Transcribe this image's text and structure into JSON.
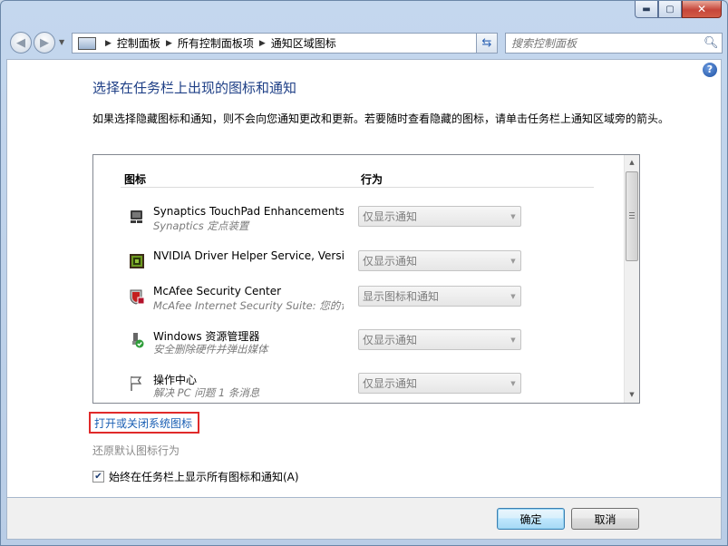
{
  "window": {
    "caption_buttons": {
      "minimize": "▬",
      "maximize": "▢",
      "close": "✕"
    }
  },
  "nav": {
    "back_glyph": "◀",
    "forward_glyph": "▶",
    "breadcrumbs": [
      "控制面板",
      "所有控制面板项",
      "通知区域图标"
    ],
    "search_placeholder": "搜索控制面板"
  },
  "page": {
    "title": "选择在任务栏上出现的图标和通知",
    "description": "如果选择隐藏图标和通知，则不会向您通知更改和更新。若要随时查看隐藏的图标，请单击任务栏上通知区域旁的箭头。",
    "columns": {
      "icon": "图标",
      "behavior": "行为"
    },
    "rows": [
      {
        "icon": "touchpad-icon",
        "name": "Synaptics TouchPad Enhancements",
        "sub": "Synaptics 定点装置",
        "behavior": "仅显示通知"
      },
      {
        "icon": "nvidia-icon",
        "name": "NVIDIA Driver Helper Service, Version ...",
        "sub": "",
        "behavior": "仅显示通知"
      },
      {
        "icon": "mcafee-icon",
        "name": "McAfee Security Center",
        "sub": "McAfee Internet Security Suite: 您的计...",
        "behavior": "显示图标和通知"
      },
      {
        "icon": "usb-safe-remove-icon",
        "name": "Windows 资源管理器",
        "sub": "安全删除硬件并弹出媒体",
        "behavior": "仅显示通知"
      },
      {
        "icon": "action-center-flag-icon",
        "name": "操作中心",
        "sub": "解决 PC 问题 1 条消息",
        "behavior": "仅显示通知"
      }
    ],
    "system_icons_link": "打开或关闭系统图标",
    "restore_link": "还原默认图标行为",
    "always_show_label": "始终在任务栏上显示所有图标和通知(A)",
    "always_show_checked": true
  },
  "footer": {
    "ok": "确定",
    "cancel": "取消"
  },
  "colors": {
    "title_blue": "#1e3f86",
    "link_blue": "#1a5fb4",
    "highlight_red": "#e02a2a"
  }
}
